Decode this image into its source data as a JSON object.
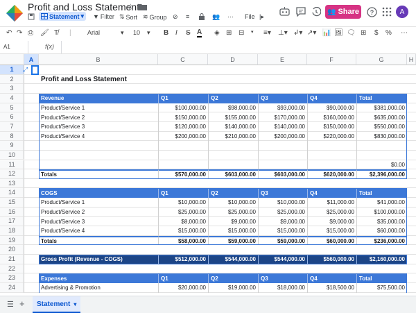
{
  "app": {
    "doc_title": "Profit and Loss Statement",
    "share_label": "Share",
    "avatar_letter": "A",
    "brand_color": "#d63384"
  },
  "toolbar1": {
    "statement_label": "Statement",
    "filter_label": "Filter",
    "sort_label": "Sort",
    "group_label": "Group",
    "file_label": "File"
  },
  "toolbar2": {
    "font_name": "Arial",
    "font_size": "10"
  },
  "formula_bar": {
    "cell_ref": "A1",
    "fx_label": "f(x)"
  },
  "columns": [
    "A",
    "B",
    "C",
    "D",
    "E",
    "F",
    "G",
    "H"
  ],
  "rows": [
    "1",
    "2",
    "3",
    "4",
    "5",
    "6",
    "7",
    "8",
    "9",
    "10",
    "11",
    "12",
    "13",
    "14",
    "15",
    "16",
    "17",
    "18",
    "19",
    "20",
    "21",
    "22",
    "23",
    "24"
  ],
  "sheet": {
    "title": "Profit and Loss Statement",
    "revenue_header": [
      "Revenue",
      "Q1",
      "Q2",
      "Q3",
      "Q4",
      "Total"
    ],
    "revenue_rows": [
      [
        "Product/Service 1",
        "$100,000.00",
        "$98,000.00",
        "$93,000.00",
        "$90,000.00",
        "$381,000.00"
      ],
      [
        "Product/Service 2",
        "$150,000.00",
        "$155,000.00",
        "$170,000.00",
        "$160,000.00",
        "$635,000.00"
      ],
      [
        "Product/Service 3",
        "$120,000.00",
        "$140,000.00",
        "$140,000.00",
        "$150,000.00",
        "$550,000.00"
      ],
      [
        "Product/Service 4",
        "$200,000.00",
        "$210,000.00",
        "$200,000.00",
        "$220,000.00",
        "$830,000.00"
      ],
      [
        "",
        "",
        "",
        "",
        "",
        ""
      ],
      [
        "",
        "",
        "",
        "",
        "",
        ""
      ],
      [
        "",
        "",
        "",
        "",
        "",
        "$0.00"
      ]
    ],
    "revenue_totals": [
      "Totals",
      "$570,000.00",
      "$603,000.00",
      "$603,000.00",
      "$620,000.00",
      "$2,396,000.00"
    ],
    "cogs_header": [
      "COGS",
      "Q1",
      "Q2",
      "Q3",
      "Q4",
      "Total"
    ],
    "cogs_rows": [
      [
        "Product/Service 1",
        "$10,000.00",
        "$10,000.00",
        "$10,000.00",
        "$11,000.00",
        "$41,000.00"
      ],
      [
        "Product/Service 2",
        "$25,000.00",
        "$25,000.00",
        "$25,000.00",
        "$25,000.00",
        "$100,000.00"
      ],
      [
        "Product/Service 3",
        "$8,000.00",
        "$9,000.00",
        "$9,000.00",
        "$9,000.00",
        "$35,000.00"
      ],
      [
        "Product/Service 4",
        "$15,000.00",
        "$15,000.00",
        "$15,000.00",
        "$15,000.00",
        "$60,000.00"
      ]
    ],
    "cogs_totals": [
      "Totals",
      "$58,000.00",
      "$59,000.00",
      "$59,000.00",
      "$60,000.00",
      "$236,000.00"
    ],
    "gross_profit": [
      "Gross Profit (Revenue - COGS)",
      "$512,000.00",
      "$544,000.00",
      "$544,000.00",
      "$560,000.00",
      "$2,160,000.00"
    ],
    "expenses_header": [
      "Expenses",
      "Q1",
      "Q2",
      "Q3",
      "Q4",
      "Total"
    ],
    "expenses_rows": [
      [
        "Advertising & Promotion",
        "$20,000.00",
        "$19,000.00",
        "$18,000.00",
        "$18,500.00",
        "$75,500.00"
      ]
    ]
  },
  "bottom": {
    "sheet_tab_label": "Statement"
  }
}
